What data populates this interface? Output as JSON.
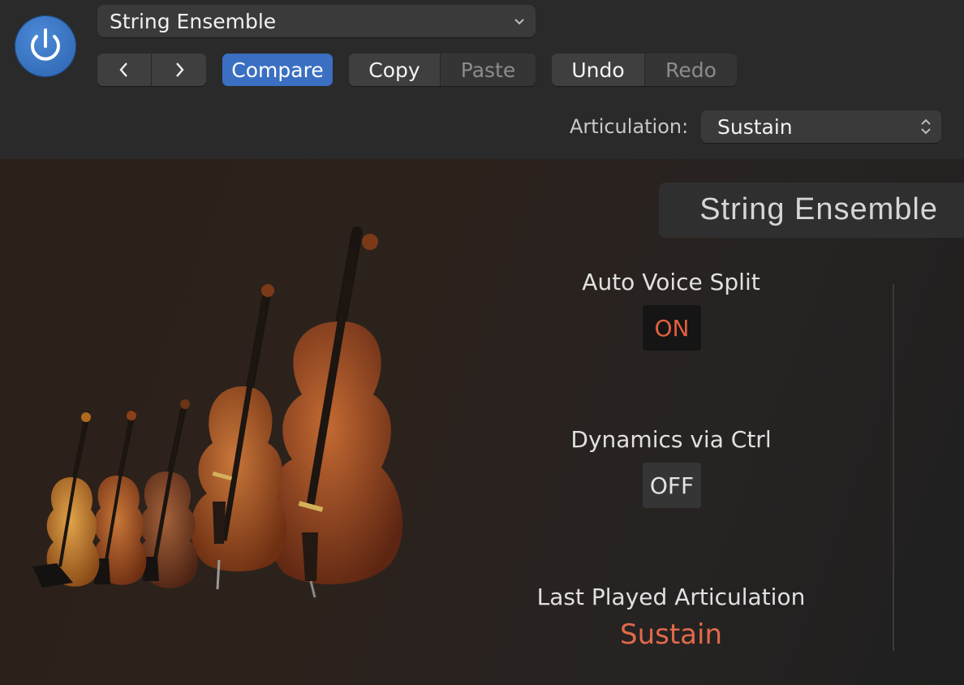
{
  "header": {
    "preset_name": "String Ensemble",
    "compare_label": "Compare",
    "copy_label": "Copy",
    "paste_label": "Paste",
    "undo_label": "Undo",
    "redo_label": "Redo",
    "articulation_label": "Articulation:",
    "articulation_value": "Sustain"
  },
  "panel": {
    "instrument_name": "String Ensemble",
    "auto_voice_split": {
      "label": "Auto Voice Split",
      "value": "ON"
    },
    "dynamics_ctrl": {
      "label": "Dynamics via Ctrl",
      "value": "OFF"
    },
    "last_played": {
      "label": "Last Played Articulation",
      "value": "Sustain"
    }
  },
  "icons": [
    "power-icon",
    "chevron-down-icon",
    "chevron-left-icon",
    "chevron-right-icon",
    "up-down-arrows-icon"
  ],
  "colors": {
    "accent_blue": "#3a6fc2",
    "active_orange": "#e0603e"
  }
}
